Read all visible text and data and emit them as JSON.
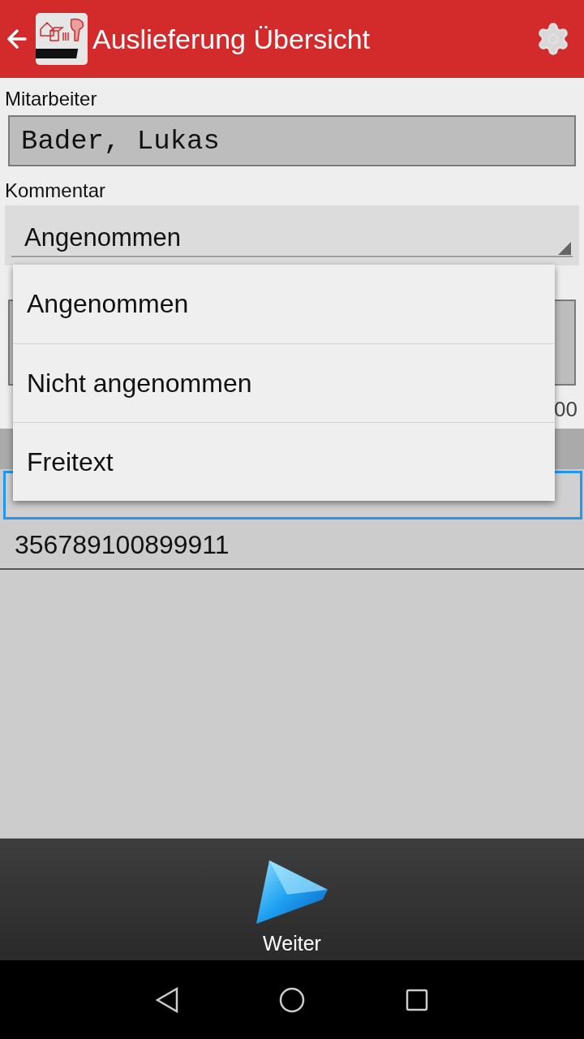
{
  "app_bar": {
    "title": "Auslieferung Übersicht"
  },
  "employee": {
    "label": "Mitarbeiter",
    "value": "Bader, Lukas"
  },
  "comment": {
    "label": "Kommentar",
    "value": "Angenommen",
    "expanded": true,
    "options": [
      {
        "label": "Angenommen"
      },
      {
        "label": "Nicht angenommen"
      },
      {
        "label": "Freitext"
      }
    ]
  },
  "remark": {
    "counter": "00"
  },
  "rows": [
    {
      "selected": true
    },
    {
      "text": "356789100899911",
      "selected": false
    }
  ],
  "footer": {
    "button": "Weiter"
  }
}
